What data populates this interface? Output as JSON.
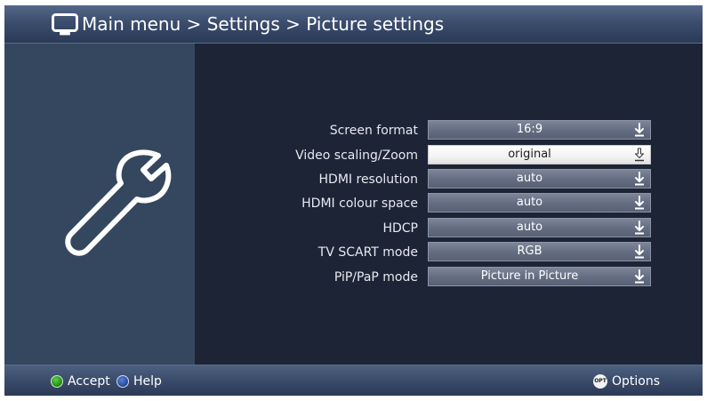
{
  "header": {
    "breadcrumb": "Main menu > Settings > Picture settings",
    "icon": "tv-icon"
  },
  "sidebar": {
    "icon": "wrench-icon"
  },
  "settings": [
    {
      "label": "Screen format",
      "value": "16:9",
      "selected": false
    },
    {
      "label": "Video scaling/Zoom",
      "value": "original",
      "selected": true
    },
    {
      "label": "HDMI resolution",
      "value": "auto",
      "selected": false
    },
    {
      "label": "HDMI colour space",
      "value": "auto",
      "selected": false
    },
    {
      "label": "HDCP",
      "value": "auto",
      "selected": false
    },
    {
      "label": "TV SCART mode",
      "value": "RGB",
      "selected": false
    },
    {
      "label": "PiP/PaP mode",
      "value": "Picture in Picture",
      "selected": false
    }
  ],
  "footer": {
    "accept_label": "Accept",
    "help_label": "Help",
    "options_label": "Options",
    "options_icon_text": "OPT"
  },
  "colors": {
    "background": "#1c2436",
    "sidebar": "#35475f",
    "field": "#656e82",
    "field_selected": "#f3f3f3",
    "accept_button": "#239418",
    "help_button": "#2b4fa3"
  }
}
